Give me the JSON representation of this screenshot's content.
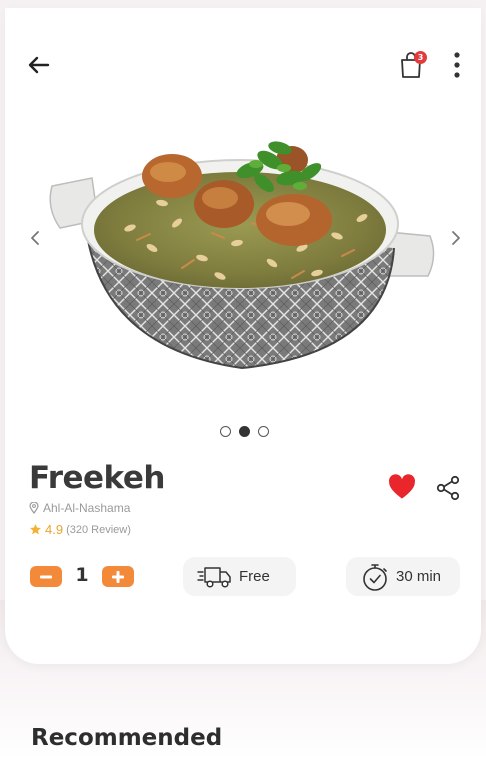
{
  "header": {
    "back_icon": "arrow-left-icon",
    "cart_icon": "shopping-bag-icon",
    "cart_badge": "3",
    "more_icon": "more-vertical-icon"
  },
  "gallery": {
    "image_alt": "Freekeh dish with chicken in a patterned bowl",
    "total_images": 3,
    "active_index": 1
  },
  "product": {
    "name": "Freekeh",
    "restaurant": "Ahl-Al-Nashama",
    "rating": "4.9",
    "reviews": "(320 Review)",
    "favorited": true,
    "quantity": "1",
    "delivery": "Free",
    "time": "30 min"
  },
  "recommended": {
    "title": "Recommended"
  },
  "colors": {
    "accent": "#f28a3a",
    "heart": "#e8262b",
    "badge": "#e23b3b",
    "star": "#f2b233"
  }
}
